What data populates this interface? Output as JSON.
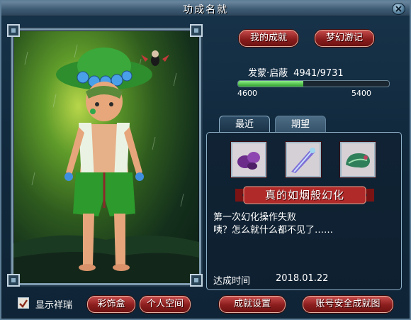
{
  "window": {
    "title": "功成名就"
  },
  "buttons": {
    "my_achievements": "我的成就",
    "dream_journey": "梦幻游记",
    "decoration_box": "彩饰盒",
    "personal_space": "个人空间",
    "achievement_settings": "成就设置",
    "account_security": "账号安全成就图"
  },
  "level": {
    "name": "发蒙·启蔽",
    "value": "4941/9731",
    "bar_min": "4600",
    "bar_max": "5400",
    "progress_fraction": 0.43
  },
  "tabs": {
    "recent": "最近",
    "expect": "期望"
  },
  "achievement": {
    "title": "真的如烟般幻化",
    "desc_line1": "第一次幻化操作失败",
    "desc_line2": "咦？怎么就什么都不见了……",
    "date_label": "达成时间",
    "date_value": "2018.01.22",
    "icons": [
      "purple-ore-icon",
      "crystal-blade-icon",
      "green-gourd-icon"
    ]
  },
  "checkbox": {
    "label": "显示祥瑞",
    "checked": true
  },
  "colors": {
    "button_red": "#8a1d1d",
    "progress_green": "#2fa02a",
    "frame": "#7f9bb0"
  }
}
